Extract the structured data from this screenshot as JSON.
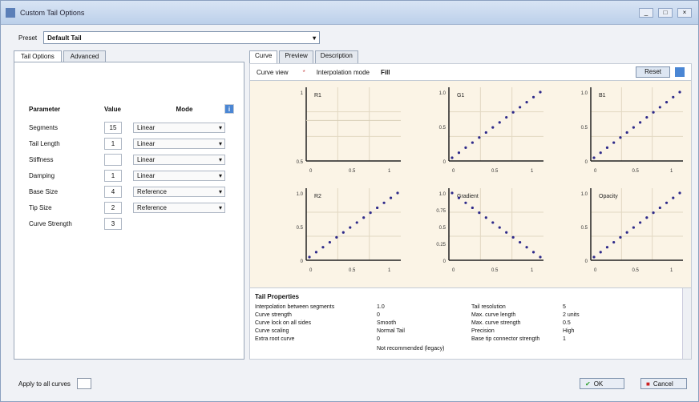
{
  "window": {
    "title": "Custom Tail Options"
  },
  "topbar": {
    "label": "Preset",
    "preset_value": "Default Tail"
  },
  "left": {
    "tabs": [
      "Tail Options",
      "Advanced"
    ],
    "headers": {
      "name": "Parameter",
      "value": "Value",
      "mode": "Mode"
    },
    "rows": [
      {
        "name": "Segments",
        "value": "15",
        "mode": "Linear"
      },
      {
        "name": "Tail Length",
        "value": "1",
        "mode": "Linear"
      },
      {
        "name": "Stiffness",
        "value": "",
        "mode": "Linear"
      },
      {
        "name": "Damping",
        "value": "1",
        "mode": "Linear"
      },
      {
        "name": "Base Size",
        "value": "4",
        "mode": "Reference"
      },
      {
        "name": "Tip Size",
        "value": "2",
        "mode": "Reference"
      },
      {
        "name": "Curve Strength",
        "value": "3",
        "mode": ""
      }
    ]
  },
  "right": {
    "tabs": [
      "Curve",
      "Preview",
      "Description"
    ],
    "controls": {
      "label1": "Curve view",
      "label2": "Interpolation mode",
      "value2": "Fill",
      "button": "Reset"
    },
    "plots": [
      {
        "title": "R1",
        "y_labels": [
          "1",
          "0.5"
        ],
        "x_labels": [
          "0",
          "0.5",
          "1"
        ]
      },
      {
        "title": "G1",
        "y_labels": [
          "1.0",
          "0.5",
          "0"
        ],
        "x_labels": [
          "0",
          "0.5",
          "1"
        ]
      },
      {
        "title": "B1",
        "y_labels": [
          "1.0",
          "0.5",
          "0"
        ],
        "x_labels": [
          "0",
          "0.5",
          "1"
        ]
      },
      {
        "title": "R2",
        "y_labels": [
          "1.0",
          "0.5",
          "0"
        ],
        "x_labels": [
          "0",
          "0.5",
          "1"
        ]
      },
      {
        "title": "Gradient",
        "y_labels": [
          "1.0",
          "0.75",
          "0.5",
          "0.25",
          "0"
        ],
        "x_labels": [
          "0",
          "0.5",
          "1"
        ]
      },
      {
        "title": "Opacity",
        "y_labels": [
          "1.0",
          "0.5",
          "0"
        ],
        "x_labels": [
          "0",
          "0.5",
          "1"
        ]
      }
    ],
    "info": {
      "title": "Tail Properties",
      "col1": [
        "Interpolation between segments",
        "Curve strength",
        "Curve lock on all sides",
        "Curve scaling",
        "Extra root curve"
      ],
      "col2": [
        "1.0",
        "0",
        "Smooth",
        "Normal Tail",
        "0"
      ],
      "col3": [
        "Tail resolution",
        "Max. curve length",
        "Max. curve strength",
        "Precision",
        "Base tip connector strength"
      ],
      "col4": [
        "5",
        "2 units",
        "0.5",
        "High",
        "1"
      ],
      "note": "Not recommended (legacy)"
    }
  },
  "bottom": {
    "label": "Apply to all curves",
    "ok": "OK",
    "cancel": "Cancel"
  }
}
